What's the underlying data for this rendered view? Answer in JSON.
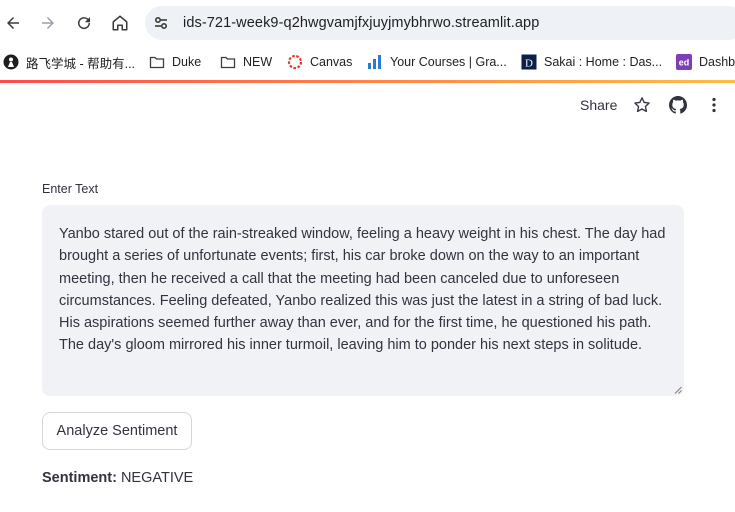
{
  "browser": {
    "url": "ids-721-week9-q2hwgvamjfxjuyjmybhrwo.streamlit.app",
    "bookmarks": [
      {
        "label": "路飞学城 - 帮助有...",
        "icon": "luffy-icon"
      },
      {
        "label": "Duke",
        "icon": "folder-icon"
      },
      {
        "label": "NEW",
        "icon": "folder-icon"
      },
      {
        "label": "Canvas",
        "icon": "canvas-icon"
      },
      {
        "label": "Your Courses | Gra...",
        "icon": "gradescope-icon"
      },
      {
        "label": "Sakai : Home : Das...",
        "icon": "sakai-icon"
      },
      {
        "label": "Dashbo",
        "icon": "ed-icon"
      }
    ]
  },
  "header": {
    "share_label": "Share"
  },
  "main": {
    "input_label": "Enter Text",
    "input_value": "Yanbo stared out of the rain-streaked window, feeling a heavy weight in his chest. The day had brought a series of unfortunate events; first, his car broke down on the way to an important meeting, then he received a call that the meeting had been canceled due to unforeseen circumstances. Feeling defeated, Yanbo realized this was just the latest in a string of bad luck. His aspirations seemed further away than ever, and for the first time, he questioned his path. The day's gloom mirrored his inner turmoil, leaving him to ponder his next steps in solitude.",
    "button_label": "Analyze Sentiment",
    "result_key": "Sentiment:",
    "result_value": "NEGATIVE"
  },
  "colors": {
    "accent_start": "#ff4b4b",
    "accent_end": "#ffbd45",
    "text": "#31333f",
    "input_bg": "#f0f2f6"
  }
}
